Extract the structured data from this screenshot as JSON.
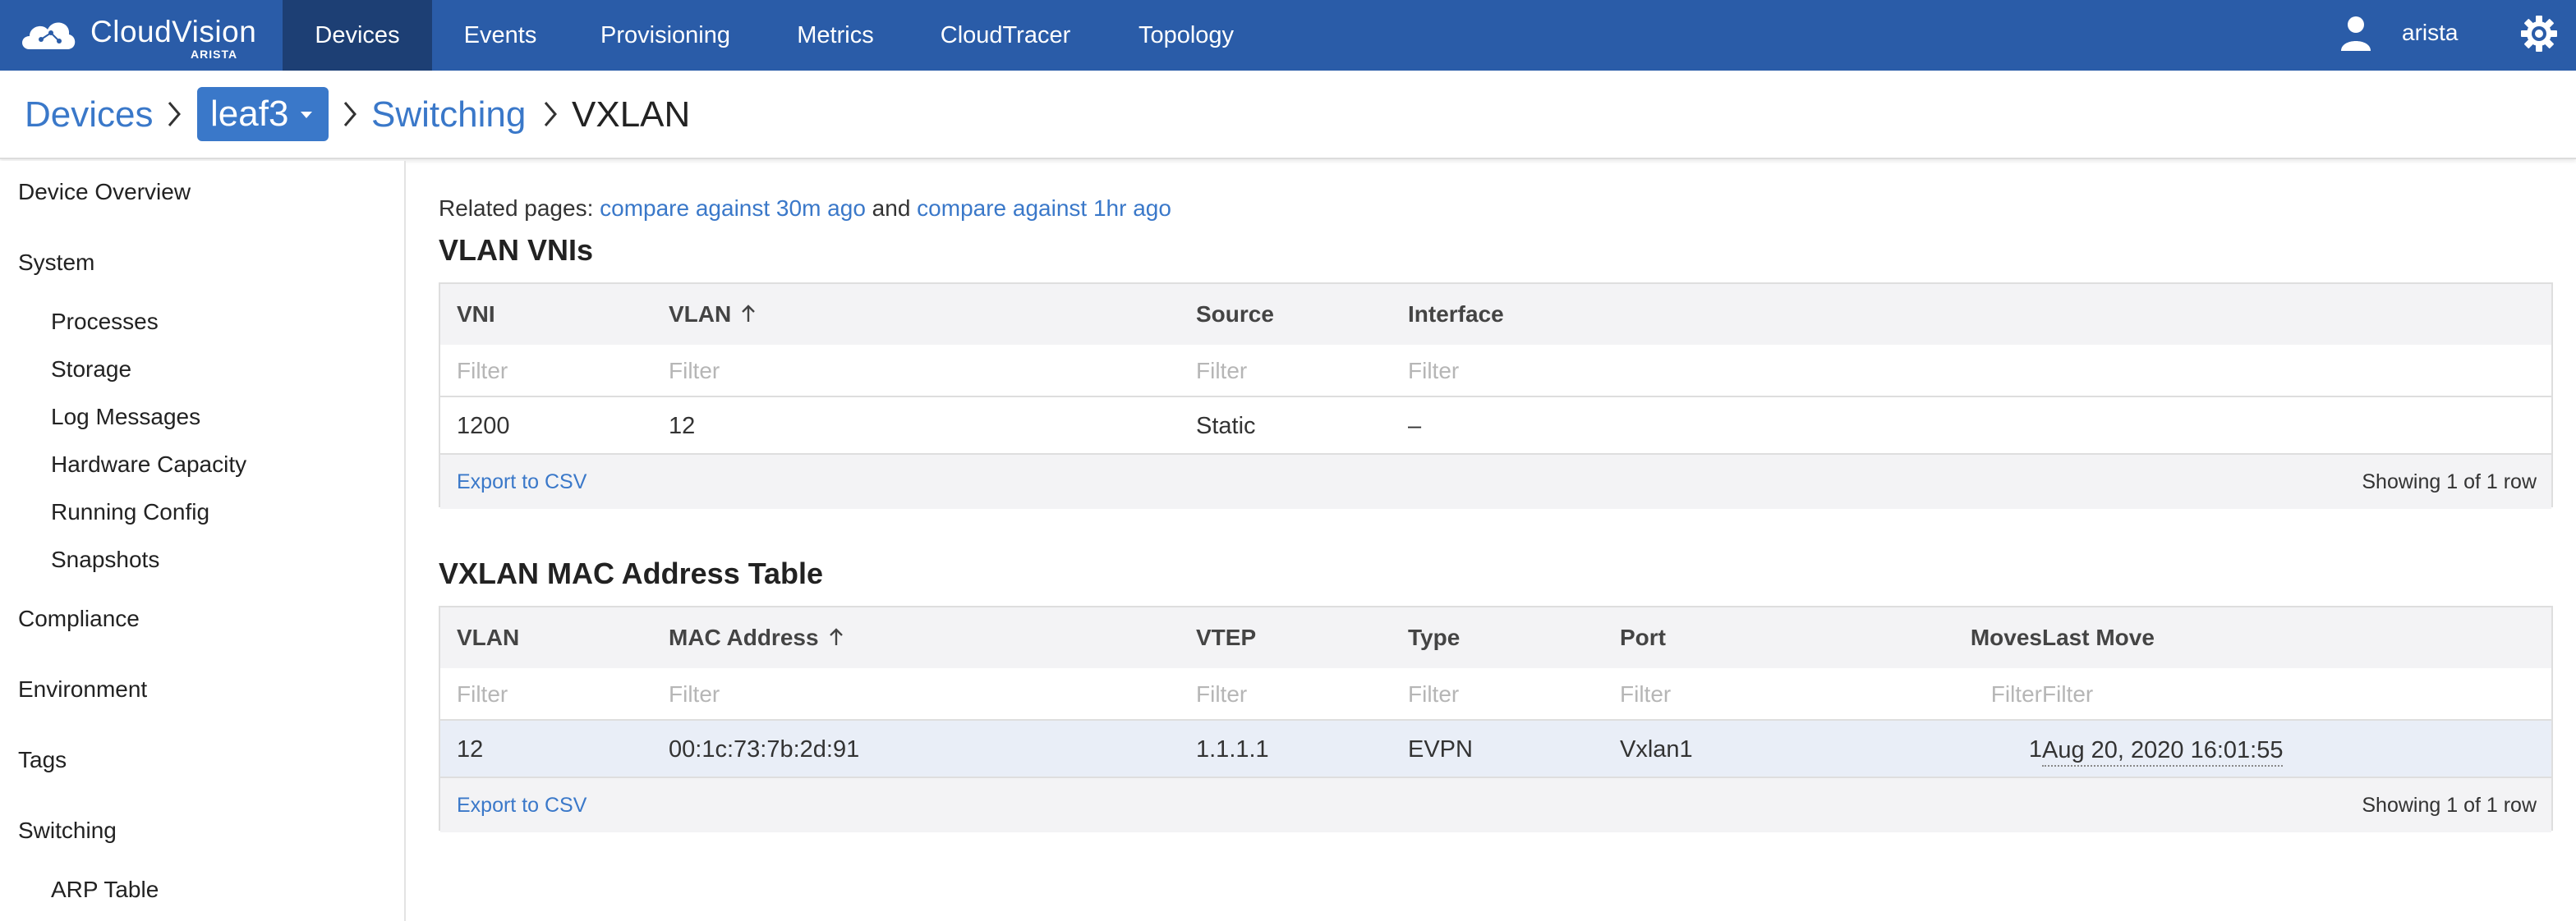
{
  "nav": {
    "brand": "CloudVision",
    "brand_sub": "ARISTA",
    "items": [
      "Devices",
      "Events",
      "Provisioning",
      "Metrics",
      "CloudTracer",
      "Topology"
    ],
    "active": "Devices",
    "user": "arista",
    "accent_color": "#2a5ca8",
    "active_color": "#1d3f74"
  },
  "breadcrumb": {
    "root": "Devices",
    "device": "leaf3",
    "section": "Switching",
    "current": "VXLAN"
  },
  "sidebar": {
    "items": [
      {
        "label": "Device Overview",
        "level": 0
      },
      {
        "label": "System",
        "level": 0
      },
      {
        "label": "Processes",
        "level": 1
      },
      {
        "label": "Storage",
        "level": 1
      },
      {
        "label": "Log Messages",
        "level": 1
      },
      {
        "label": "Hardware Capacity",
        "level": 1
      },
      {
        "label": "Running Config",
        "level": 1
      },
      {
        "label": "Snapshots",
        "level": 1
      },
      {
        "label": "Compliance",
        "level": 0
      },
      {
        "label": "Environment",
        "level": 0
      },
      {
        "label": "Tags",
        "level": 0
      },
      {
        "label": "Switching",
        "level": 0
      },
      {
        "label": "ARP Table",
        "level": 1
      }
    ]
  },
  "related": {
    "prefix": "Related pages:",
    "link1": "compare against 30m ago",
    "conj": "and",
    "link2": "compare against 1hr ago"
  },
  "vni_table": {
    "title": "VLAN VNIs",
    "columns": [
      "VNI",
      "VLAN",
      "Source",
      "Interface"
    ],
    "sorted_column": "VLAN",
    "filter_placeholder": "Filter",
    "rows": [
      [
        "1200",
        "12",
        "Static",
        "–"
      ]
    ],
    "export_label": "Export to CSV",
    "showing": "Showing 1 of 1 row"
  },
  "mac_table": {
    "title": "VXLAN MAC Address Table",
    "columns": [
      "VLAN",
      "MAC Address",
      "VTEP",
      "Type",
      "Port",
      "Moves",
      "Last Move"
    ],
    "sorted_column": "MAC Address",
    "filter_placeholder": "Filter",
    "rows": [
      [
        "12",
        "00:1c:73:7b:2d:91",
        "1.1.1.1",
        "EVPN",
        "Vxlan1",
        "1",
        "Aug 20, 2020 16:01:55"
      ]
    ],
    "export_label": "Export to CSV",
    "showing": "Showing 1 of 1 row"
  }
}
